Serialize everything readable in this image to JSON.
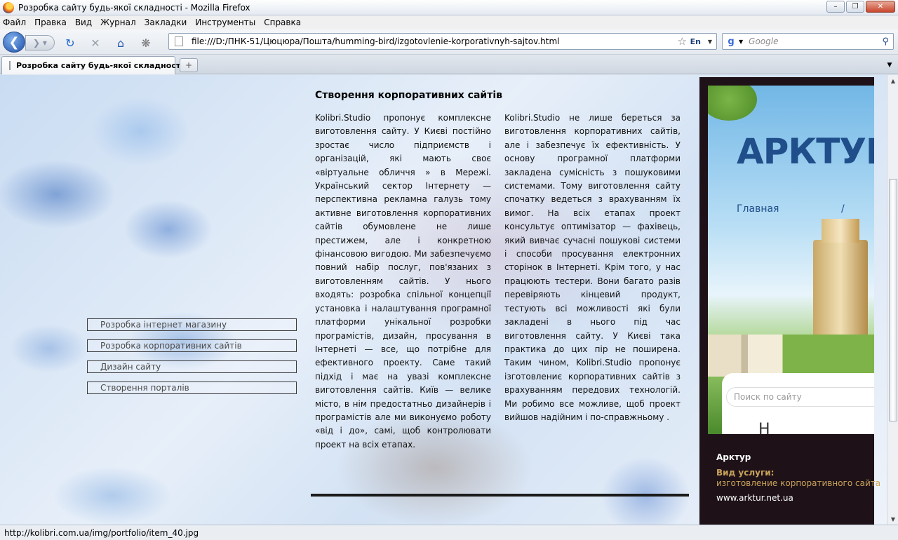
{
  "window": {
    "title": "Розробка сайту будь-якої складності - Mozilla Firefox"
  },
  "menu": [
    "Файл",
    "Правка",
    "Вид",
    "Журнал",
    "Закладки",
    "Инструменты",
    "Справка"
  ],
  "nav": {
    "url": "file:///D:/ПНК-51/Цюцюра/Пошта/humming-bird/izgotovlenie-korporativnyh-sajtov.html",
    "lang_badge": "En",
    "search_placeholder": "Google",
    "search_engine_icon": "g-icon"
  },
  "tabs": [
    {
      "label": "Розробка сайту будь-якої складності",
      "active": true
    }
  ],
  "page": {
    "heading": "Створення корпоративних сайтів",
    "column1": "Kolibri.Studio пропонує комплексне виготовлення сайту. У Києві постійно зростає число підприємств і організацій, які мають своє «віртуальне обличчя » в Мережі. Український сектор Інтернету — перспективна рекламна галузь тому активне виготовлення корпоративних сайтів обумовлене не лише престижем, але і конкретною фінансовою вигодою. Ми забезпечуємо повний набір послуг, пов'язаних з виготовленням сайтів. У нього входять: розробка спільної концепції установка і налаштування програмної платформи унікальної розробки програмістів, дизайн, просування в Інтернеті — все, що потрібне для ефективного проекту. Саме такий підхід і має на увазі комплексне виготовлення сайтів. Київ — велике місто, в нім предостатньо дизайнерів і програмістів але ми виконуємо роботу «від і до», самі, щоб контролювати проект на всіх етапах.",
    "column2": "Kolibri.Studio не лише береться за виготовлення корпоративних сайтів, але і забезпечує їх ефективність. У основу програмної платформи закладена сумісність з пошуковими системами. Тому виготовлення сайту спочатку ведеться з врахуванням їх вимог. На всіх етапах проект консультує оптимізатор — фахівець, який вивчає сучасні пошукові системи і способи просування електронних сторінок в Інтернеті. Крім того, у нас працюють тестери. Вони багато разів перевіряють кінцевий продукт, тестують всі можливості які були закладені в нього під час виготовлення сайту. У Києві така практика до цих пір не поширена. Таким чином, Kolibri.Studio пропонує ізготовлениє корпоративних сайтів з врахуванням передових технологій. Ми робимо все можливе, щоб проект вийшов надійним і по-справжньому .",
    "sidenav": [
      "Розробка інтернет магазину",
      "Розробка корпоративних сайтів",
      "Дизайн сайту",
      "Створення порталів"
    ]
  },
  "portfolio": {
    "screenshot": {
      "logo": "АРКТУР",
      "menu_home": "Главная",
      "menu_sep": "/",
      "search_placeholder": "Поиск по сайту",
      "partial_letter": "Н"
    },
    "name": "Арктур",
    "service_label": "Вид услуги:",
    "service": "изготовление корпоративного сайта",
    "url": "www.arktur.net.ua"
  },
  "status": {
    "text": "http://kolibri.com.ua/img/portfolio/item_40.jpg"
  }
}
